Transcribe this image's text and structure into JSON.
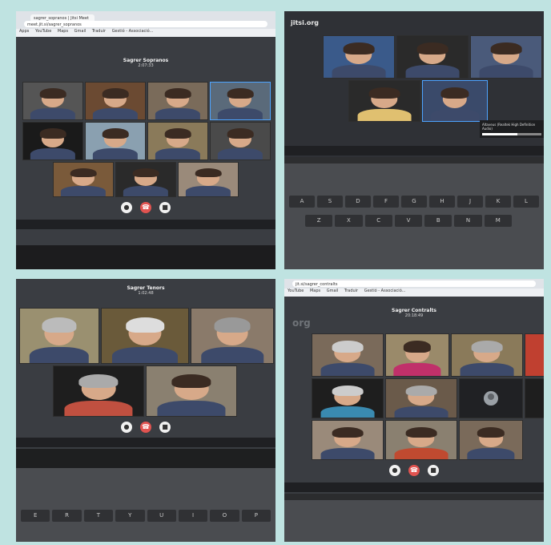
{
  "photos": {
    "sopranos": {
      "browser_tab": "sagrer_sopranos | Jitsi Meet",
      "url": "meet.jit.si/sagrer_sopranos",
      "bookmarks": [
        "Apps",
        "YouTube",
        "Maps",
        "Gmail",
        "Traduir",
        "Gestió - Associació..."
      ],
      "room_name": "Sagrer Sopranos",
      "timer": "2:07:33"
    },
    "jitsi": {
      "logo_text": "jitsi.org",
      "volume_label": "Altaveus (Realtek High Definition Audio)",
      "keyboard_row1": [
        "A",
        "S",
        "D",
        "F",
        "G",
        "H",
        "J",
        "K",
        "L"
      ],
      "keyboard_row2": [
        "Z",
        "X",
        "C",
        "V",
        "B",
        "N",
        "M"
      ]
    },
    "tenors": {
      "room_name": "Sagrer Tenors",
      "timer": "1:02:48",
      "keyboard_row": [
        "E",
        "R",
        "T",
        "Y",
        "U",
        "I",
        "O",
        "P"
      ]
    },
    "contralts": {
      "url": "jit.si/sagrer_contralts",
      "bookmarks": [
        "YouTube",
        "Maps",
        "Gmail",
        "Traduir",
        "Gestió - Associació..."
      ],
      "org_text": "org",
      "room_name": "Sagrer Contralts",
      "timer": "20:18:49"
    }
  },
  "controls": {
    "mic_icon": "microphone-icon",
    "hangup_icon": "hangup-icon",
    "camera_icon": "camera-icon"
  },
  "colors": {
    "page_background": "#bfe3e1",
    "hangup": "#e15350",
    "active_speaker": "#4da3ff"
  }
}
